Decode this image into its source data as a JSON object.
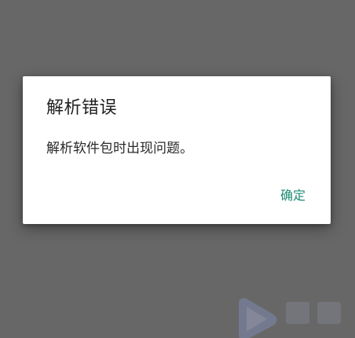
{
  "dialog": {
    "title": "解析错误",
    "message": "解析软件包时出现问题。",
    "confirm_label": "确定"
  },
  "colors": {
    "scrim": "#676767",
    "dialog_background": "#ffffff",
    "accent": "#1e8c74",
    "title_text": "#202020",
    "body_text": "#2a2a2a"
  },
  "watermark": {
    "icon": "play-logo-icon"
  }
}
